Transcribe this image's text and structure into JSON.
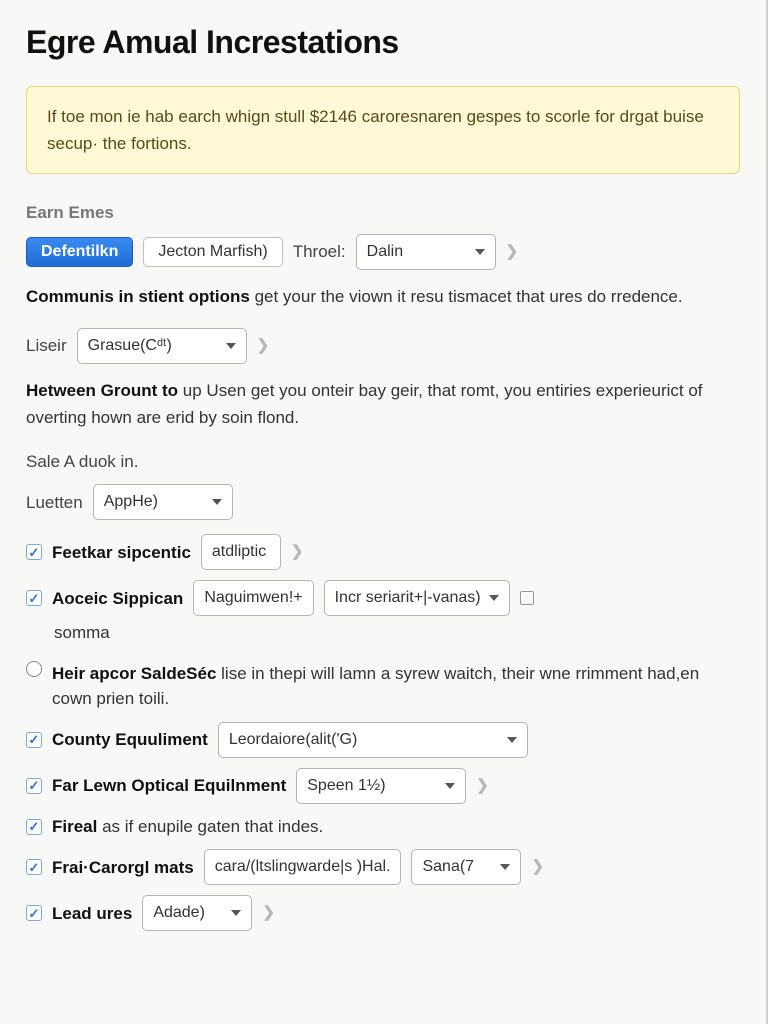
{
  "title": "Egre Amual Increstations",
  "notice": "If toe mon ie hab earch whign stull $2146 caroresnaren gespes to scorle for drgat buise secup· the fortions.",
  "earn": {
    "section_label": "Earn Emes",
    "primary_btn": "Defentilkn",
    "secondary_btn": "Jecton Marfish)",
    "throel_label": "Throel:",
    "throel_value": "Dalin"
  },
  "para1_bold": "Communis in stient options",
  "para1_rest": " get your the viown it resu tismacet that ures do rredence.",
  "liseir": {
    "label": "Liseir",
    "value": "Grasue(Cᵈᵗ)"
  },
  "para2_bold": "Hetween Grount to",
  "para2_rest": " up Usen get you onteir bay geir, that romt, you entiries experieurict of overting hown are erid by soin flond.",
  "sale_text": "Sale A duok in.",
  "luetten": {
    "label": "Luetten",
    "value": "AppHe)"
  },
  "feetkar": {
    "checked": true,
    "label": "Feetkar sipcentic",
    "input_value": "atdliptic"
  },
  "aoceic": {
    "checked": true,
    "label": "Aoceic Sippican",
    "input_value": "Naguimwen!+",
    "select_value": "Incr seriarit+|-vanas)",
    "trailing": "somma"
  },
  "heir": {
    "bold": "Heir apcor SaldeSéc",
    "rest": " lise in thepi will lamn a syrew waitch, their wne rrimment had,en cown prien toili."
  },
  "county": {
    "checked": true,
    "label": "County Equuliment",
    "value": "Leordaiore(alit('G)"
  },
  "farlewn": {
    "checked": true,
    "label": "Far Lewn Optical Equilnment",
    "value": "Speen 1½)"
  },
  "fireal": {
    "checked": true,
    "bold": "Fireal",
    "rest": " as if enupile gaten that indes."
  },
  "frai": {
    "checked": true,
    "label": "Frai·Carorgl mats",
    "input_value": "cara/(ltslingwarde|s )Hal.",
    "select_value": "Sana(7"
  },
  "lead": {
    "checked": true,
    "label": "Lead ures",
    "value": "Adade)"
  }
}
